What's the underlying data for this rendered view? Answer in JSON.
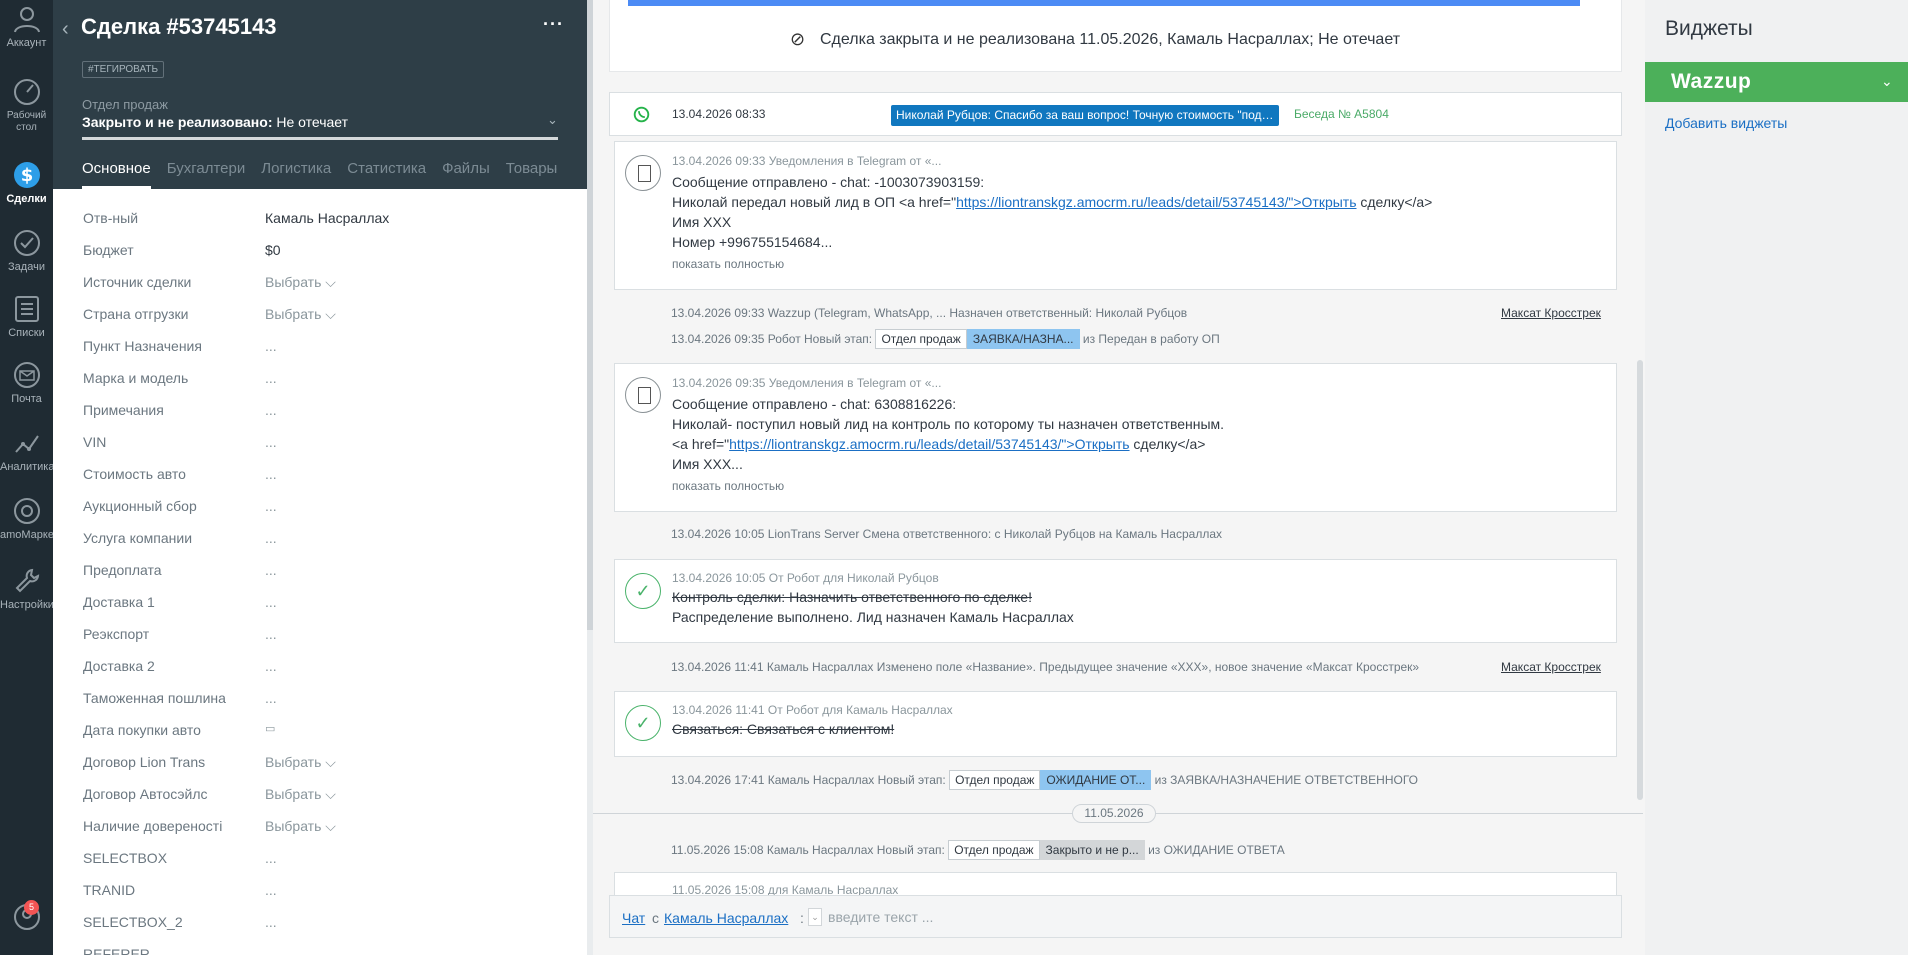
{
  "nav": {
    "items": [
      {
        "label": "Аккаунт"
      },
      {
        "label": "Рабочий стол"
      },
      {
        "label": "Сделки"
      },
      {
        "label": "Задачи"
      },
      {
        "label": "Списки"
      },
      {
        "label": "Почта"
      },
      {
        "label": "Аналитика"
      },
      {
        "label": "amoМаркет"
      },
      {
        "label": "Настройки"
      }
    ],
    "notifications": "5"
  },
  "deal": {
    "title": "Сделка #53745143",
    "more": "···",
    "tag_button": "#ТЕГИРОВАТЬ",
    "pipeline": "Отдел продаж",
    "status_bold": "Закрыто и не реализовано:",
    "status_reason": " Не отечает",
    "tabs": [
      "Основное",
      "Бухгалтери",
      "Логистика",
      "Статистика",
      "Файлы",
      "Товары"
    ],
    "tabs_more": "···",
    "fields": [
      {
        "label": "Отв-ный",
        "value": "Камаль Насраллах"
      },
      {
        "label": "Бюджет",
        "value": "$0"
      },
      {
        "label": "Источник сделки",
        "value": "Выбрать ⌵"
      },
      {
        "label": "Страна отгрузки",
        "value": "Выбрать ⌵"
      },
      {
        "label": "Пункт Назначения",
        "value": "..."
      },
      {
        "label": "Марка и модель",
        "value": "..."
      },
      {
        "label": "Примечания",
        "value": "..."
      },
      {
        "label": "VIN",
        "value": "..."
      },
      {
        "label": "Стоимость авто",
        "value": "..."
      },
      {
        "label": "Аукционный сбор",
        "value": "..."
      },
      {
        "label": "Услуга компании",
        "value": "..."
      },
      {
        "label": "Предоплата",
        "value": "..."
      },
      {
        "label": "Доставка 1",
        "value": "..."
      },
      {
        "label": "Реэкспорт",
        "value": "..."
      },
      {
        "label": "Доставка 2",
        "value": "..."
      },
      {
        "label": "Таможенная пошлина",
        "value": "..."
      },
      {
        "label": "Дата покупки авто",
        "value": "▭"
      },
      {
        "label": "Договор Lion Trans",
        "value": "Выбрать ⌵"
      },
      {
        "label": "Договор Автосэйлс",
        "value": "Выбрать ⌵"
      },
      {
        "label": "Наличие довереностi",
        "value": "Выбрать ⌵"
      },
      {
        "label": "SELECTBOX",
        "value": "..."
      },
      {
        "label": "TRANID",
        "value": "..."
      },
      {
        "label": "SELECTBOX_2",
        "value": "..."
      },
      {
        "label": "REFERER",
        "value": ""
      }
    ]
  },
  "feed": {
    "closed_banner": "Сделка закрыта и не реализована 11.05.2026, Камаль Насраллах; Не отечает",
    "chat": {
      "datetime": "13.04.2026 08:33",
      "message": "Николай Рубцов: Спасибо за ваш вопрос! Точную стоимость \"под ключ\" рассчитает наш эксперт, учитывая ...",
      "conversation": "Беседа № A5804"
    },
    "note1": {
      "head": "13.04.2026 09:33 Уведомления в Telegram от «...",
      "line1": "Сообщение отправлено - chat: -1003073903159:",
      "line2_pre": "Николай передал новый лид в ОП <a href=\"",
      "line2_link": "https://liontranskgz.amocrm.ru/leads/detail/53745143/\">Открыть",
      "line2_post": " сделку</a>",
      "line3": "Имя XXX",
      "line4": "Номер +996755154684...",
      "more": "показать полностью"
    },
    "event1": {
      "text": "13.04.2026 09:33 Wazzup (Telegram, WhatsApp, ... Назначен ответственный: Николай Рубцов",
      "link": "Максат Кросстрек"
    },
    "event2": {
      "text": "13.04.2026 09:35 Робот Новый этап:",
      "pipeline": "Отдел продаж",
      "stage": "ЗАЯВКА/НАЗНА...",
      "from": "из Передан в работу ОП"
    },
    "note2": {
      "head": "13.04.2026 09:35 Уведомления в Telegram от «...",
      "line1": "Сообщение отправлено - chat: 6308816226:",
      "line2": "Николай- поступил новый лид на контроль по которому ты назначен ответственным.",
      "line3_pre": "<a href=\"",
      "line3_link": "https://liontranskgz.amocrm.ru/leads/detail/53745143/\">Открыть",
      "line3_post": " сделку</a>",
      "line4": "Имя XXX...",
      "more": "показать полностью"
    },
    "event3": {
      "text": "13.04.2026 10:05 LionTrans Server Смена ответственного: с Николай Рубцов на Камаль Насраллах"
    },
    "task1": {
      "head": "13.04.2026 10:05  От Робот для Николай Рубцов",
      "task": "Контроль сделки: Назначить ответственного по сделке!",
      "result": "Распределение выполнено. Лид назначен Камаль Насраллах"
    },
    "event4": {
      "text": "13.04.2026 11:41 Камаль Насраллах Изменено поле «Название». Предыдущее значение «XXX», новое значение «Максат Кросстрек»",
      "link": "Максат Кросстрек"
    },
    "task2": {
      "head": "13.04.2026 11:41  От Робот для Камаль Насраллах",
      "task": "Связаться: Связаться с клиентом!"
    },
    "event5": {
      "text": "13.04.2026 17:41 Камаль Насраллах Новый этап:",
      "pipeline": "Отдел продаж",
      "stage": "ОЖИДАНИЕ ОТ...",
      "from": "из ЗАЯВКА/НАЗНАЧЕНИЕ ОТВЕТСТВЕННОГО"
    },
    "date_divider": "11.05.2026",
    "event6": {
      "text": "11.05.2026 15:08 Камаль Насраллах Новый этап:",
      "pipeline": "Отдел продаж",
      "stage": "Закрыто и не р...",
      "from": "из ОЖИДАНИЕ ОТВЕТА"
    },
    "bottom_card": {
      "head": "11.05.2026 15:08  для Камаль Насраллах"
    },
    "composer": {
      "chat": "Чат",
      "with": "с",
      "contact": "Камаль Насраллах",
      "colon": ":",
      "placeholder": "введите текст ..."
    }
  },
  "widgets": {
    "title": "Виджеты",
    "wazzup": "Wazzup",
    "add": "Добавить виджеты"
  },
  "colors": {
    "accent": "#4cb05a",
    "header": "#2e3e47",
    "nav": "#1f2b33",
    "link": "#1b6fc4"
  }
}
